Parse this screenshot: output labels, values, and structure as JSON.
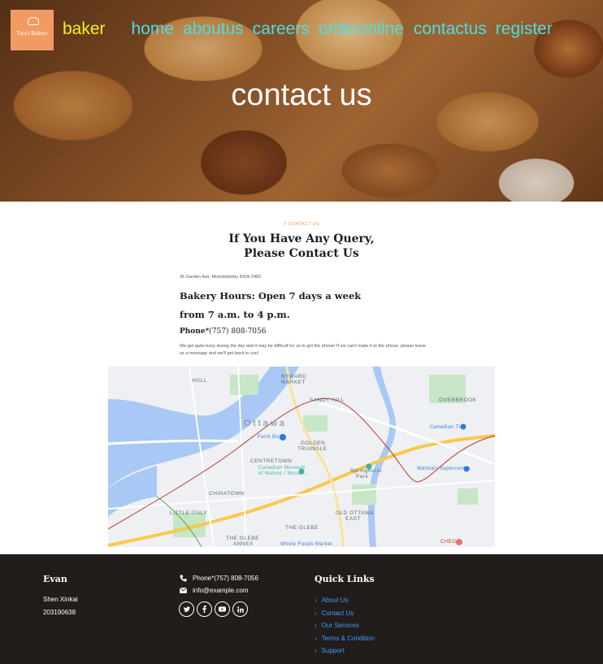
{
  "header": {
    "logo_text": "Tara's Bakery",
    "brand": "baker",
    "nav": [
      "home",
      "aboutus",
      "careers",
      "orderonline",
      "contactus",
      "register"
    ],
    "hero_title": "contact us"
  },
  "content": {
    "eyebrow": "// CONTACT US",
    "heading_line1": "If You Have Any Query,",
    "heading_line2": "Please Contact Us",
    "address": "36 Garden Ave, Mullumbimby NSW 2482",
    "hours_line1": "Bakery Hours: Open 7 days a week",
    "hours_line2": "from 7 a.m. to 4 p.m.",
    "phone_label": "Phone*",
    "phone_number": "(757) 808-7056",
    "note": "We get quite busy during the day and it may be difficult for us to get the phone! If we can't make it to the phone, please leave us a message and we'll get back to you!"
  },
  "map": {
    "labels": {
      "hull": "HULL",
      "byward": "BYWARD",
      "market": "MARKET",
      "sandy_hill": "SANDY HILL",
      "overbrook": "OVERBROOK",
      "ottawa": "Ottawa",
      "farm_boy": "Farm Boy",
      "golden": "GOLDEN",
      "triangle": "TRIANGLE",
      "centretown": "CENTRETOWN",
      "museum1": "Canadian Museum",
      "museum2": "of Nature / Musée...",
      "chinatown": "CHINATOWN",
      "little_italy": "LITTLE ITALY",
      "springhurst1": "Springhurst",
      "springhurst2": "Park",
      "old_ottawa": "OLD OTTAWA",
      "east": "EAST",
      "glebe": "THE GLEBE",
      "glebe_annex1": "THE GLEBE",
      "glebe_annex2": "ANNEX",
      "whole_foods": "Whole Foods Market",
      "walmart": "Walmart Supercentre",
      "canadian_tire": "Canadian Tire",
      "cheo": "CHEO"
    }
  },
  "footer": {
    "col1_title": "Evan",
    "name": "Shen Xinkai",
    "id": "203190638",
    "phone": "Phone*(757) 808-7056",
    "email": "info@example.com",
    "socials": [
      "twitter",
      "facebook",
      "youtube",
      "linkedin"
    ],
    "quick_links_title": "Quick Links",
    "quick_links": [
      "About Us",
      "Contact Us",
      "Our Services",
      "Terms & Condition",
      "Support"
    ]
  },
  "colors": {
    "brand": "#f2f21a",
    "nav": "#46e0e6",
    "accent": "#f29a63",
    "footer_bg": "#221c1a",
    "link": "#3aa0ff"
  }
}
